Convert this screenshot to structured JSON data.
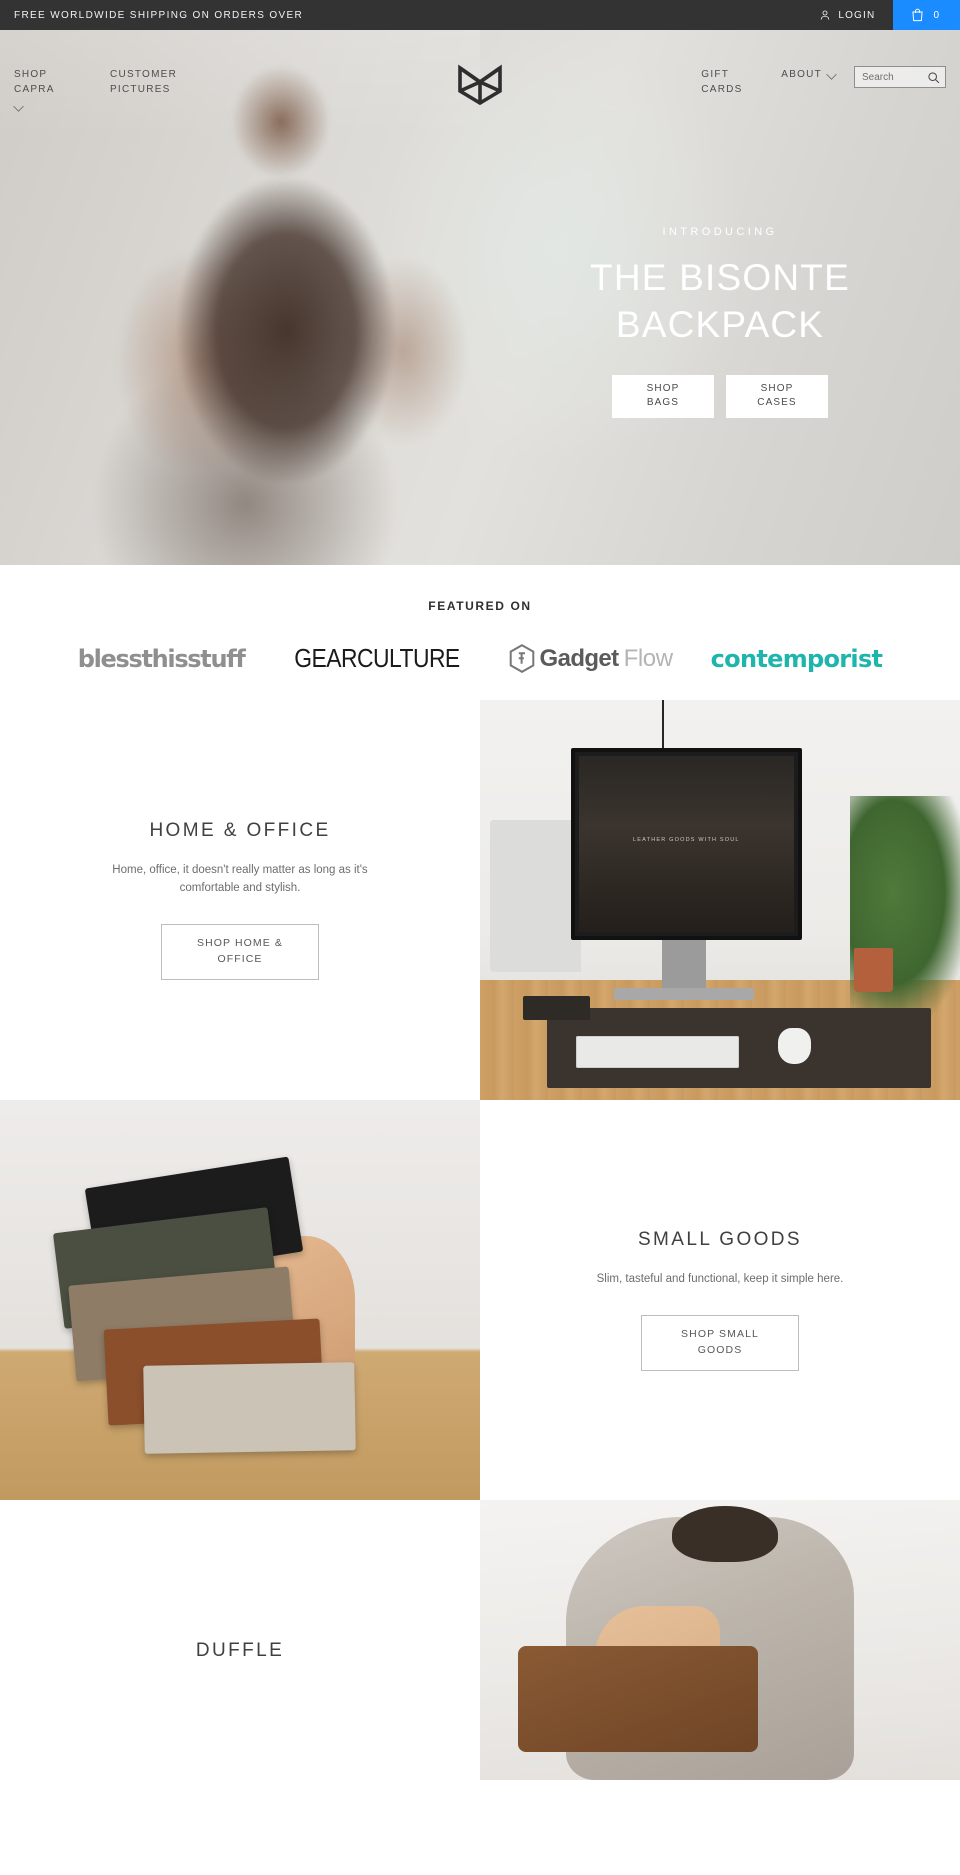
{
  "announce": {
    "message": "FREE WORLDWIDE SHIPPING ON ORDERS OVER",
    "login_label": "LOGIN",
    "login_icon": "user-icon",
    "cart_icon": "shopping-bag-icon",
    "cart_count": "0",
    "cart_color": "#1a8cff",
    "bar_color": "#333333"
  },
  "nav": {
    "logo_name": "capra-leather-logo",
    "left_items": [
      {
        "label": "SHOP CAPRA",
        "icon": "chevron-down-icon",
        "has_chevron": true
      },
      {
        "label": "CUSTOMER PICTURES",
        "has_chevron": false
      }
    ],
    "right_items": [
      {
        "label": "GIFT CARDS",
        "has_chevron": false
      },
      {
        "label": "ABOUT",
        "icon": "chevron-down-icon",
        "has_chevron": true
      }
    ],
    "search": {
      "placeholder": "Search",
      "value": "",
      "icon": "search-icon"
    }
  },
  "hero": {
    "kicker": "INTRODUCING",
    "title_line1": "THE BISONTE",
    "title_line2": "BACKPACK",
    "buttons": [
      {
        "line1": "SHOP",
        "line2": "BAGS"
      },
      {
        "line1": "SHOP",
        "line2": "CASES"
      }
    ]
  },
  "featured": {
    "title": "FEATURED ON",
    "logos": [
      {
        "name": "blessthisstuff",
        "text": "blessthisstuff",
        "color": "#8f8f8f"
      },
      {
        "name": "gearculture",
        "text": "GEARCULTURE",
        "color": "#1b1b1b"
      },
      {
        "name": "gadgetflow",
        "text_bold": "Gadget",
        "text_light": "Flow",
        "icon": "hexagon-f-icon",
        "color": "#5b5b5b"
      },
      {
        "name": "contemporist",
        "text": "contemporist",
        "color": "#1eb5ad"
      }
    ]
  },
  "promos": [
    {
      "id": "home-office",
      "title": "HOME & OFFICE",
      "description": "Home, office, it doesn't really matter as long as it's comfortable and stylish.",
      "button_line1": "SHOP HOME &",
      "button_line2": "OFFICE",
      "image_name": "desk-setup-photo",
      "image_caption": "LEATHER GOODS WITH SOUL",
      "image_side": "right"
    },
    {
      "id": "small-goods",
      "title": "SMALL GOODS",
      "description": "Slim, tasteful and functional, keep it simple here.",
      "button_line1": "SHOP SMALL",
      "button_line2": "GOODS",
      "image_name": "wallets-in-hand-photo",
      "image_side": "left"
    },
    {
      "id": "duffle",
      "title": "DUFFLE",
      "description": "",
      "button_line1": "",
      "button_line2": "",
      "image_name": "duffle-bag-model-photo",
      "image_side": "right"
    }
  ]
}
